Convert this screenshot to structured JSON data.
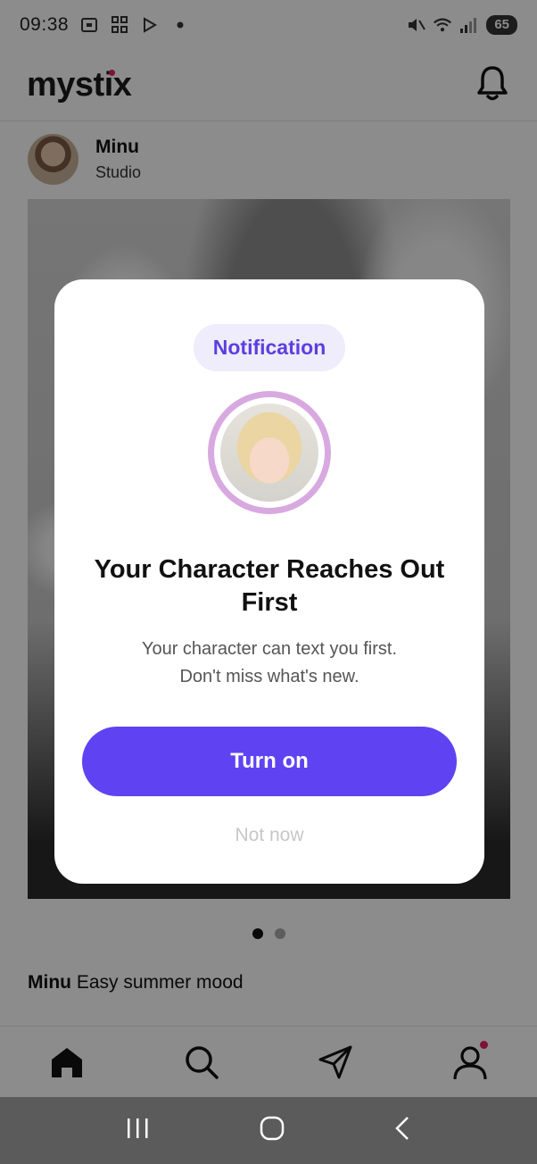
{
  "status_bar": {
    "time": "09:38",
    "battery": "65",
    "signal_label": "5"
  },
  "header": {
    "logo": "mystix"
  },
  "post": {
    "author": "Minu",
    "subtitle": "Studio",
    "caption_author": "Minu",
    "caption_text": "Easy summer mood",
    "page_indicator": {
      "total": 2,
      "current": 1
    }
  },
  "modal": {
    "chip": "Notification",
    "title": "Your Character Reaches Out First",
    "description_line1": "Your character can text you first.",
    "description_line2": "Don't miss what's new.",
    "primary_button": "Turn on",
    "secondary_button": "Not now"
  },
  "nav": {
    "items": [
      "home-icon",
      "search-icon",
      "send-icon",
      "profile-icon"
    ]
  },
  "colors": {
    "accent": "#5f43f2",
    "chip_bg": "#efecfb",
    "ring": "#d8a9e0",
    "badge": "#e0245e"
  }
}
